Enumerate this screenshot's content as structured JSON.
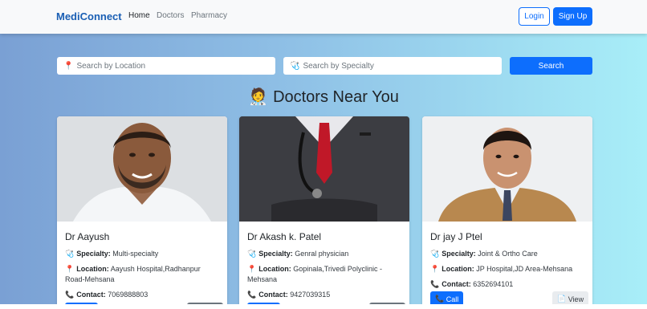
{
  "nav": {
    "brand": "MediConnect",
    "links": [
      "Home",
      "Doctors",
      "Pharmacy"
    ],
    "login": "Login",
    "signup": "Sign Up"
  },
  "search": {
    "location_placeholder": "Search by Location",
    "specialty_placeholder": "Search by Specialty",
    "button": "Search"
  },
  "section_title": "Doctors Near You",
  "labels": {
    "specialty": "Specialty:",
    "location": "Location:",
    "contact": "Contact:",
    "call": "Call",
    "view": "View"
  },
  "doctors": [
    {
      "name": "Dr Aayush",
      "specialty": "Multi-specialty",
      "location": "Aayush Hospital,Radhanpur Road-Mehsana",
      "contact": "7069888803"
    },
    {
      "name": "Dr Akash k. Patel",
      "specialty": "Genral physician",
      "location": "Gopinala,Trivedi Polyclinic - Mehsana",
      "contact": "9427039315"
    },
    {
      "name": "Dr jay J Ptel",
      "specialty": "Joint & Ortho Care",
      "location": "JP Hospital,JD Area-Mehsana",
      "contact": "6352694101"
    }
  ]
}
